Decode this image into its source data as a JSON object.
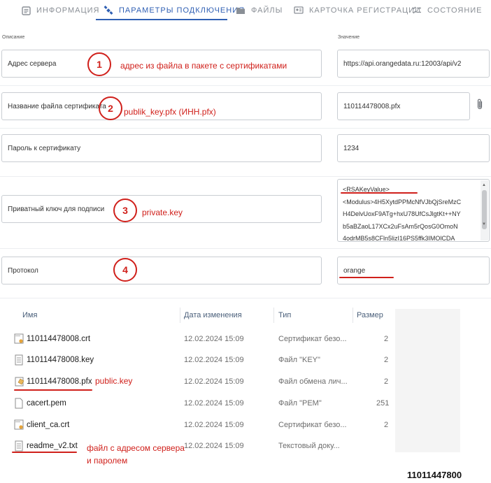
{
  "tabs": [
    {
      "label": "ИНФОРМАЦИЯ",
      "icon": "document-icon",
      "active": false
    },
    {
      "label": "ПАРАМЕТРЫ ПОДКЛЮЧЕНИЯ",
      "icon": "satellite-icon",
      "active": true
    },
    {
      "label": "ФАЙЛЫ",
      "icon": "folder-icon",
      "active": false
    },
    {
      "label": "КАРТОЧКА РЕГИСТРАЦИИ",
      "icon": "id-card-icon",
      "active": false
    },
    {
      "label": "СОСТОЯНИЕ",
      "icon": "checklist-icon",
      "active": false
    }
  ],
  "columns": {
    "description": "Описание",
    "value": "Значение"
  },
  "fields": {
    "server": {
      "label": "Адрес сервера",
      "value": "https://api.orangedata.ru:12003/api/v2"
    },
    "cert_file": {
      "label": "Название файла сертификата",
      "value": "110114478008.pfx"
    },
    "cert_password": {
      "label": "Пароль к сертификату",
      "value": "1234"
    },
    "private_key": {
      "label": "Приватный ключ для подписи",
      "lines": [
        "<RSAKeyValue>",
        "<Modulus>4H5XytdPPMcNfVJbQjSreMzC",
        "H4DelvUoxF9ATg+hxU78UfCsJlgtKt++NY",
        "b5aBZaoL17XCx2uFsAm5rQosG0OmoN",
        "4odrMB5s8CFln5lizI16PS5ffk3IMOlCDA"
      ]
    },
    "protocol": {
      "label": "Протокол",
      "value": "orange"
    }
  },
  "annotations": {
    "n1": "1",
    "n2": "2",
    "n3": "3",
    "n4": "4",
    "note1": "адрес из файла в пакете с сертификатами",
    "note2": "publik_key.pfx (ИНН.pfx)",
    "note3": "private.key",
    "note_pfx": "public.key",
    "note_readme_1": "файл с адресом сервера",
    "note_readme_2": "и паролем"
  },
  "explorer": {
    "headers": {
      "name": "Имя",
      "date": "Дата изменения",
      "type": "Тип",
      "size": "Размер"
    },
    "files": [
      {
        "name": "110114478008.crt",
        "date": "12.02.2024 15:09",
        "type": "Сертификат безо...",
        "size": "2",
        "icon": "certificate-file-icon"
      },
      {
        "name": "110114478008.key",
        "date": "12.02.2024 15:09",
        "type": "Файл \"KEY\"",
        "size": "2",
        "icon": "text-file-icon"
      },
      {
        "name": "110114478008.pfx",
        "date": "12.02.2024 15:09",
        "type": "Файл обмена лич...",
        "size": "2",
        "icon": "pfx-file-icon"
      },
      {
        "name": "cacert.pem",
        "date": "12.02.2024 15:09",
        "type": "Файл \"PEM\"",
        "size": "251",
        "icon": "blank-file-icon"
      },
      {
        "name": "client_ca.crt",
        "date": "12.02.2024 15:09",
        "type": "Сертификат безо...",
        "size": "2",
        "icon": "certificate-file-icon"
      },
      {
        "name": "readme_v2.txt",
        "date": "12.02.2024 15:09",
        "type": "Текстовый доку...",
        "size": "",
        "icon": "text-file-icon"
      }
    ]
  },
  "bottom_text": "11011447800",
  "colors": {
    "accent": "#2f5fb3",
    "annotation": "#d0201b"
  }
}
